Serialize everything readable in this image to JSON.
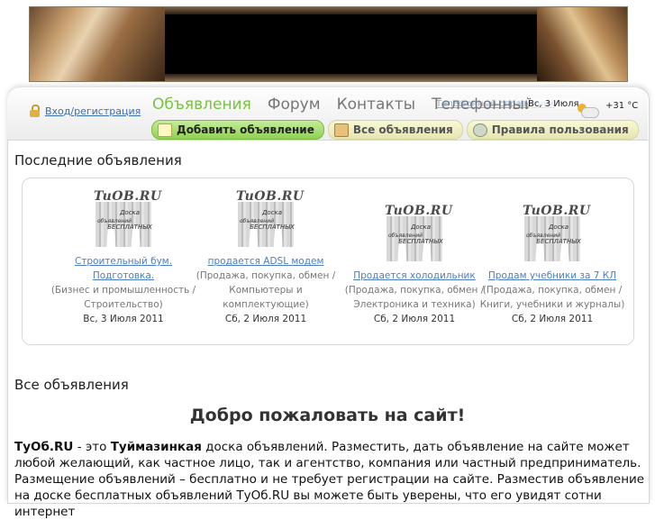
{
  "header": {
    "login_label": "Вход/регистрация",
    "menu": [
      "Объявления",
      "Форум",
      "Контакты",
      "Телефонный справочник"
    ],
    "active_menu": "Объявления",
    "ghost_link": "Телефонный справочник",
    "date": "Вс, 3 Июля",
    "temperature": "+31 °C"
  },
  "subnav": {
    "add": "Добавить объявление",
    "all": "Все объявления",
    "rules": "Правила пользования"
  },
  "latest": {
    "heading": "Последние объявления",
    "logo_text": "TuOB.RU",
    "logo_tag": "Доска БЕСПЛАТНЫХ",
    "logo_tag2": "объявлений",
    "items": [
      {
        "title": "Строительный бум. Подготовка.",
        "category": "(Бизнес и промышленность / Строительство)",
        "date": "Вс, 3 Июля 2011"
      },
      {
        "title": "продается ADSL модем",
        "category": "(Продажа, покупка, обмен / Компьютеры и комплектующие)",
        "date": "Сб, 2 Июля 2011"
      },
      {
        "title": "Продается холодильник",
        "category": "(Продажа, покупка, обмен / Электроника и техника)",
        "date": "Сб, 2 Июля 2011"
      },
      {
        "title": "Продам учебники за 7 КЛ",
        "category": "(Продажа, покупка, обмен / Книги, учебники и журналы)",
        "date": "Сб, 2 Июля 2011"
      }
    ]
  },
  "all": {
    "heading": "Все объявления",
    "welcome": "Добро пожаловать на сайт!",
    "site_name": "ТуОб.RU",
    "p1": " - это ",
    "city": "Туймазинкая",
    "p2": " доска объявлений. Разместить, дать объявление на сайте может любой желающий, как частное лицо, так и агентство, компания или частный предприниматель. Размещение объявлений – бесплатно и не требует регистрации на сайте. Разместив объявление на доске бесплатных объявлений ТуОб.RU вы можете быть уверены, что его увидят сотни интернет"
  }
}
